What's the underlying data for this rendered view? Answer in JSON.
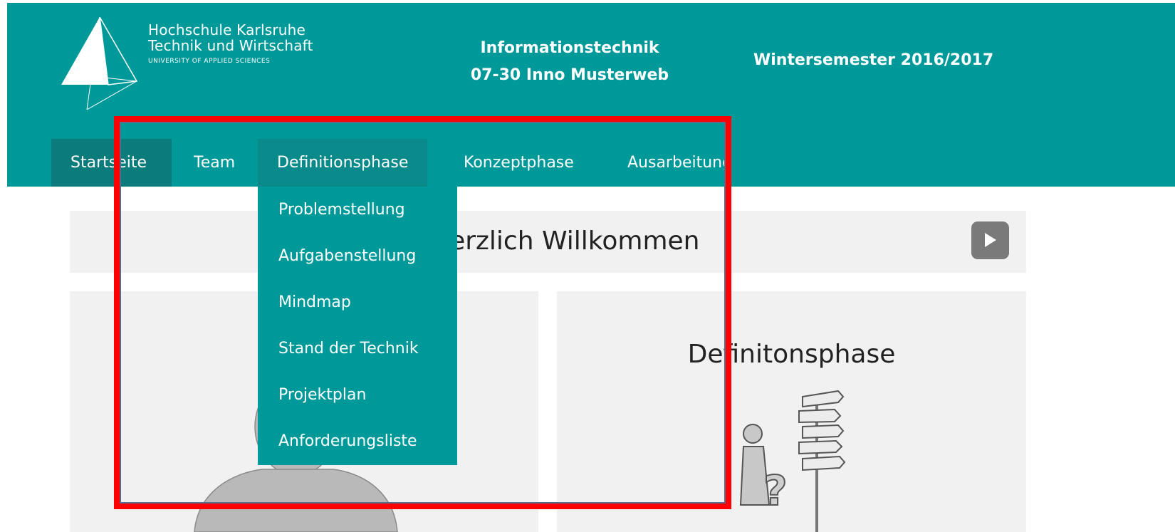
{
  "header": {
    "logo": {
      "line1": "Hochschule Karlsruhe",
      "line2": "Technik und Wirtschaft",
      "line3": "UNIVERSITY OF APPLIED SCIENCES"
    },
    "course_line1": "Informationstechnik",
    "course_line2": "07-30 Inno Musterweb",
    "semester": "Wintersemester 2016/2017"
  },
  "nav": {
    "items": [
      {
        "label": "Startseite",
        "state": "active"
      },
      {
        "label": "Team"
      },
      {
        "label": "Definitionsphase",
        "state": "open"
      },
      {
        "label": "Konzeptphase"
      },
      {
        "label": "Ausarbeitung"
      }
    ]
  },
  "dropdown": {
    "items": [
      {
        "label": "Problemstellung"
      },
      {
        "label": "Aufgabenstellung"
      },
      {
        "label": "Mindmap"
      },
      {
        "label": "Stand der Technik"
      },
      {
        "label": "Projektplan"
      },
      {
        "label": "Anforderungsliste"
      }
    ]
  },
  "welcome": {
    "title": "Herzlich Willkommen",
    "play_icon": "play-icon"
  },
  "panels": {
    "right_title": "Definitonsphase"
  },
  "colors": {
    "brand": "#00999a",
    "nav_active": "#0c7b7b",
    "highlight": "#ff0000",
    "panel_bg": "#f1f1f1"
  }
}
